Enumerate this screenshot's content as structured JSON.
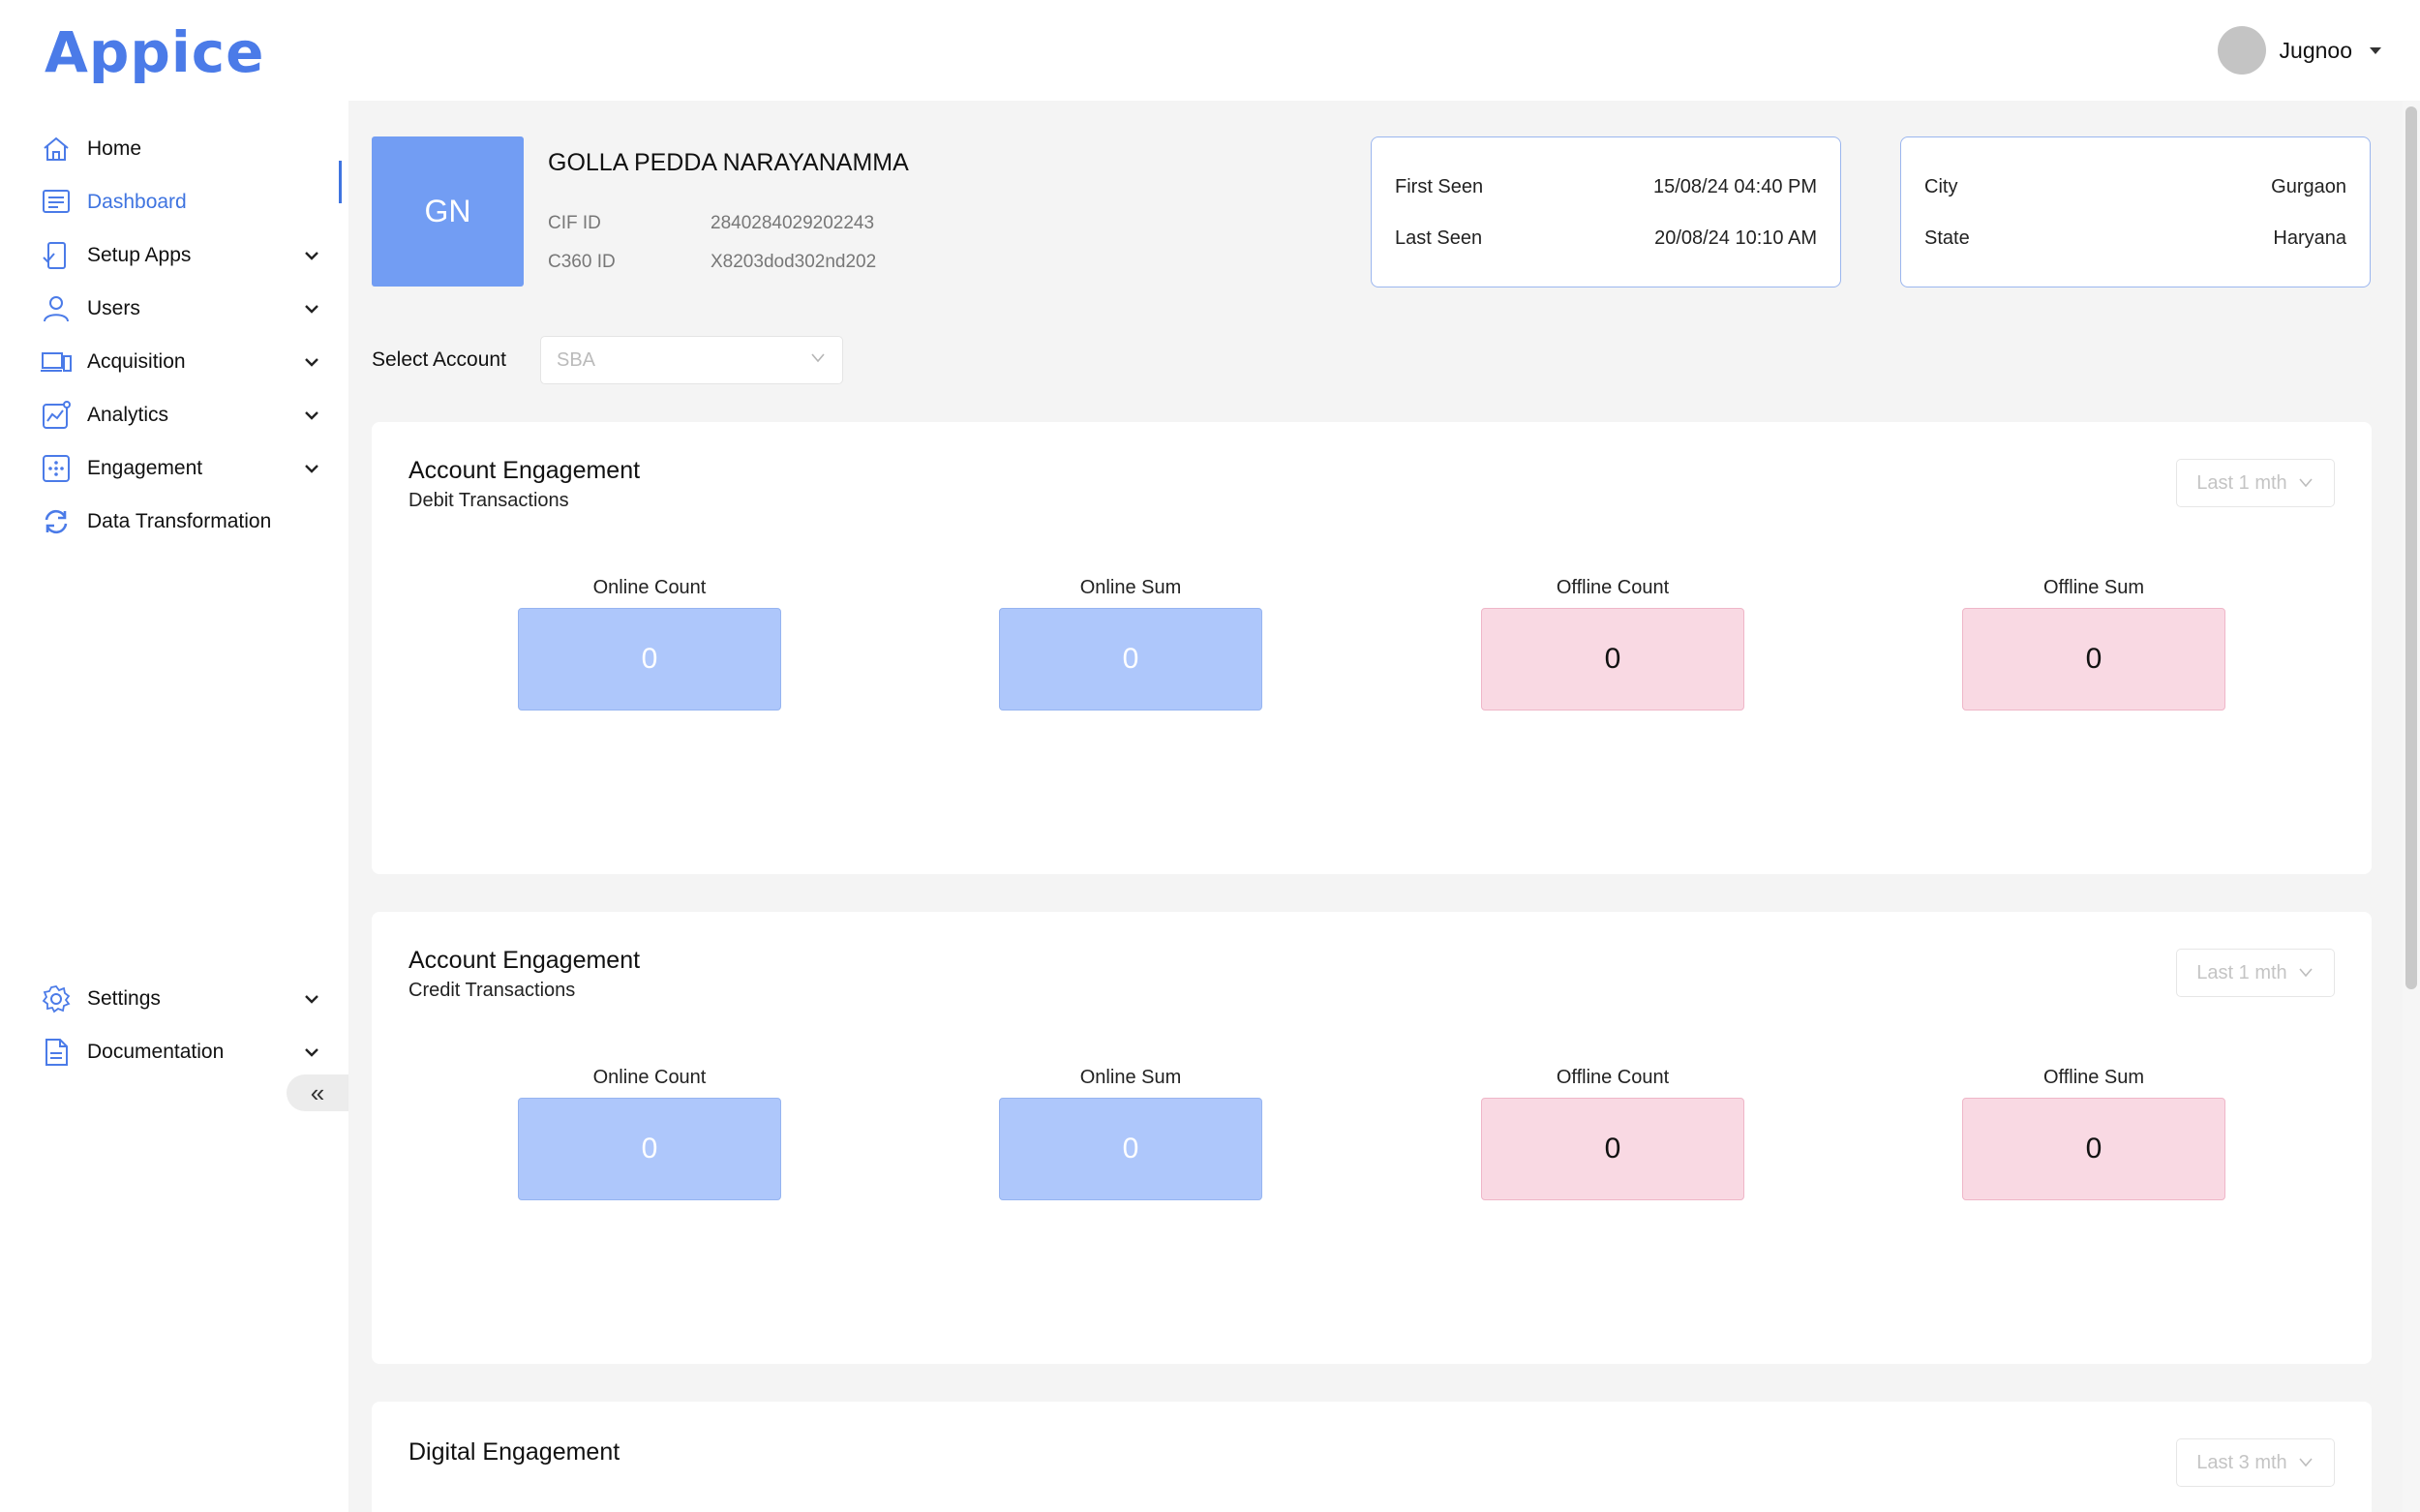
{
  "app": {
    "logo": "Appice"
  },
  "user": {
    "name": "Jugnoo"
  },
  "sidebar": {
    "items": [
      {
        "label": "Home",
        "icon": "home-icon",
        "has_children": false
      },
      {
        "label": "Dashboard",
        "icon": "dashboard-icon",
        "has_children": false,
        "active": true
      },
      {
        "label": "Setup Apps",
        "icon": "setup-apps-icon",
        "has_children": true
      },
      {
        "label": "Users",
        "icon": "user-icon",
        "has_children": true
      },
      {
        "label": "Acquisition",
        "icon": "devices-icon",
        "has_children": true
      },
      {
        "label": "Analytics",
        "icon": "analytics-icon",
        "has_children": true
      },
      {
        "label": "Engagement",
        "icon": "engagement-icon",
        "has_children": true
      },
      {
        "label": "Data Transformation",
        "icon": "sync-icon",
        "has_children": false
      }
    ],
    "bottom_items": [
      {
        "label": "Settings",
        "icon": "gear-icon",
        "has_children": true
      },
      {
        "label": "Documentation",
        "icon": "document-icon",
        "has_children": true
      }
    ],
    "collapse_label": "«"
  },
  "profile": {
    "initials": "GN",
    "name": "GOLLA PEDDA NARAYANAMMA",
    "cif_label": "CIF ID",
    "cif_value": "2840284029202243",
    "c360_label": "C360 ID",
    "c360_value": "X8203dod302nd202"
  },
  "seen_card": {
    "first_seen_label": "First Seen",
    "first_seen_value": "15/08/24 04:40 PM",
    "last_seen_label": "Last Seen",
    "last_seen_value": "20/08/24 10:10 AM"
  },
  "location_card": {
    "city_label": "City",
    "city_value": "Gurgaon",
    "state_label": "State",
    "state_value": "Haryana"
  },
  "account_select": {
    "label": "Select Account",
    "value": "SBA"
  },
  "panels": [
    {
      "title": "Account Engagement",
      "subtitle": "Debit Transactions",
      "range": "Last 1 mth",
      "metrics": [
        {
          "label": "Online Count",
          "value": "0"
        },
        {
          "label": "Online Sum",
          "value": "0"
        },
        {
          "label": "Offline Count",
          "value": "0"
        },
        {
          "label": "Offline Sum",
          "value": "0"
        }
      ]
    },
    {
      "title": "Account Engagement",
      "subtitle": "Credit Transactions",
      "range": "Last 1 mth",
      "metrics": [
        {
          "label": "Online Count",
          "value": "0"
        },
        {
          "label": "Online Sum",
          "value": "0"
        },
        {
          "label": "Offline Count",
          "value": "0"
        },
        {
          "label": "Offline Sum",
          "value": "0"
        }
      ]
    },
    {
      "title": "Digital Engagement",
      "range": "Last 3 mth"
    }
  ],
  "colors": {
    "accent": "#3f74e0",
    "online_tile": "#aec7fb",
    "offline_tile": "#f9d9e3",
    "profile_tile": "#729df3"
  }
}
